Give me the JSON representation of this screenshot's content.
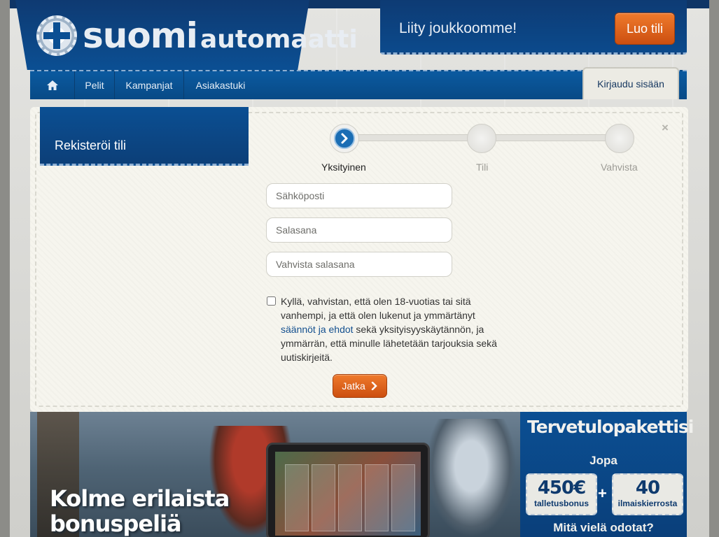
{
  "logo": {
    "word1": "suomi",
    "word2": "automaatti"
  },
  "join": {
    "text": "Liity joukkoomme!",
    "button": "Luo tili"
  },
  "nav": {
    "items": [
      "Pelit",
      "Kampanjat",
      "Asiakastuki"
    ],
    "login": "Kirjaudu sisään"
  },
  "modal": {
    "tab_title": "Rekisteröi tili",
    "close": "×",
    "steps": [
      {
        "label": "Yksityinen",
        "active": true
      },
      {
        "label": "Tili",
        "active": false
      },
      {
        "label": "Vahvista",
        "active": false
      }
    ],
    "fields": {
      "email_placeholder": "Sähköposti",
      "password_placeholder": "Salasana",
      "confirm_placeholder": "Vahvista salasana"
    },
    "terms": {
      "before": "Kyllä, vahvistan, että olen 18-vuotias tai sitä vanhempi, ja että olen lukenut ja ymmärtänyt ",
      "link": "säännöt ja ehdot",
      "after": " sekä yksityisyyskäytännön, ja ymmärrän, että minulle lähetetään tarjouksia sekä uutiskirjeitä."
    },
    "continue_button": "Jatka"
  },
  "hero": {
    "line1": "Kolme erilaista",
    "line2": "bonuspeliä"
  },
  "promo": {
    "heading": "Tervetulopakettisi",
    "intro": "Jopa",
    "box1_value": "450€",
    "box1_label": "talletusbonus",
    "plus": "+",
    "box2_value": "40",
    "box2_label": "ilmaiskierrosta",
    "bottom": "Mitä vielä odotat?"
  }
}
